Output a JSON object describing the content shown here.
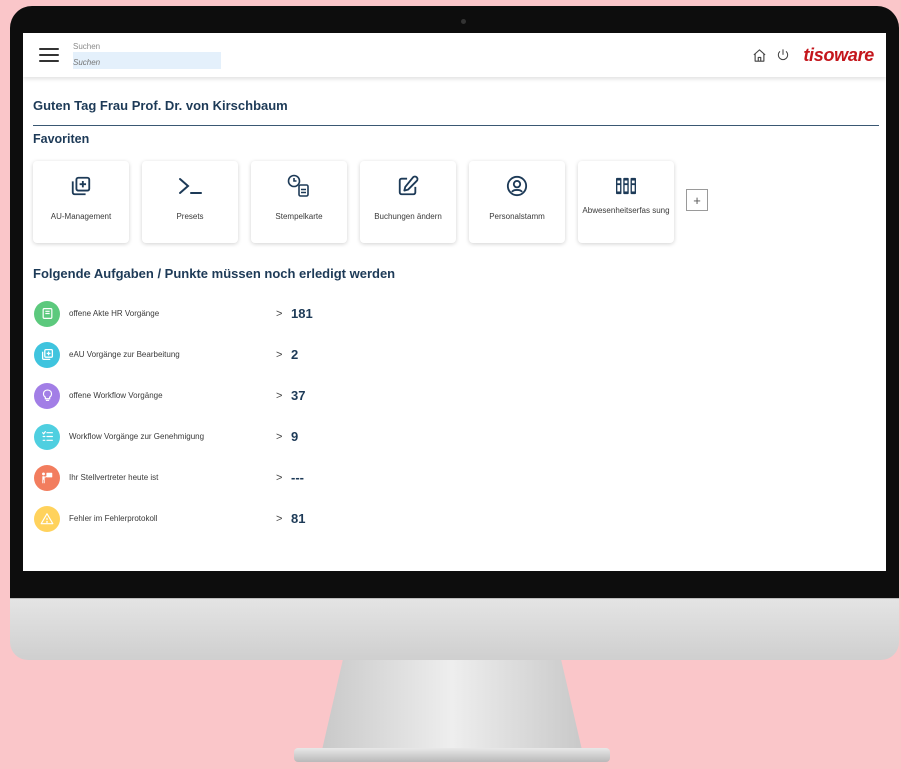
{
  "header": {
    "search_label": "Suchen",
    "search_placeholder": "Suchen",
    "logo_text": "tisoware",
    "icons": [
      "home-icon",
      "power-icon"
    ]
  },
  "greeting": "Guten Tag Frau Prof. Dr. von Kirschbaum",
  "favorites": {
    "title": "Favoriten",
    "items": [
      {
        "label": "AU-Management",
        "icon": "stacked-plus-icon"
      },
      {
        "label": "Presets",
        "icon": "terminal-icon"
      },
      {
        "label": "Stempelkarte",
        "icon": "clock-card-icon"
      },
      {
        "label": "Buchungen ändern",
        "icon": "edit-icon"
      },
      {
        "label": "Personalstamm",
        "icon": "person-circle-icon"
      },
      {
        "label": "Abwesenheitserfas sung",
        "icon": "binders-icon"
      }
    ],
    "add_label": "+"
  },
  "tasks": {
    "title": "Folgende Aufgaben / Punkte müssen noch erledigt werden",
    "chevron": ">",
    "items": [
      {
        "label": "offene Akte HR Vorgänge",
        "value": "181",
        "color": "#5cc97d",
        "icon": "book-icon"
      },
      {
        "label": "eAU Vorgänge zur Bearbeitung",
        "value": "2",
        "color": "#3fc4de",
        "icon": "stacked-plus-icon"
      },
      {
        "label": "offene Workflow Vorgänge",
        "value": "37",
        "color": "#a27ee6",
        "icon": "lightbulb-icon"
      },
      {
        "label": "Workflow Vorgänge zur Genehmigung",
        "value": "9",
        "color": "#4fcfe0",
        "icon": "checklist-icon"
      },
      {
        "label": "Ihr Stellvertreter heute ist",
        "value": "---",
        "color": "#f27d5e",
        "icon": "person-board-icon"
      },
      {
        "label": "Fehler im Fehlerprotokoll",
        "value": "81",
        "color": "#ffd25c",
        "icon": "warning-icon"
      }
    ]
  }
}
